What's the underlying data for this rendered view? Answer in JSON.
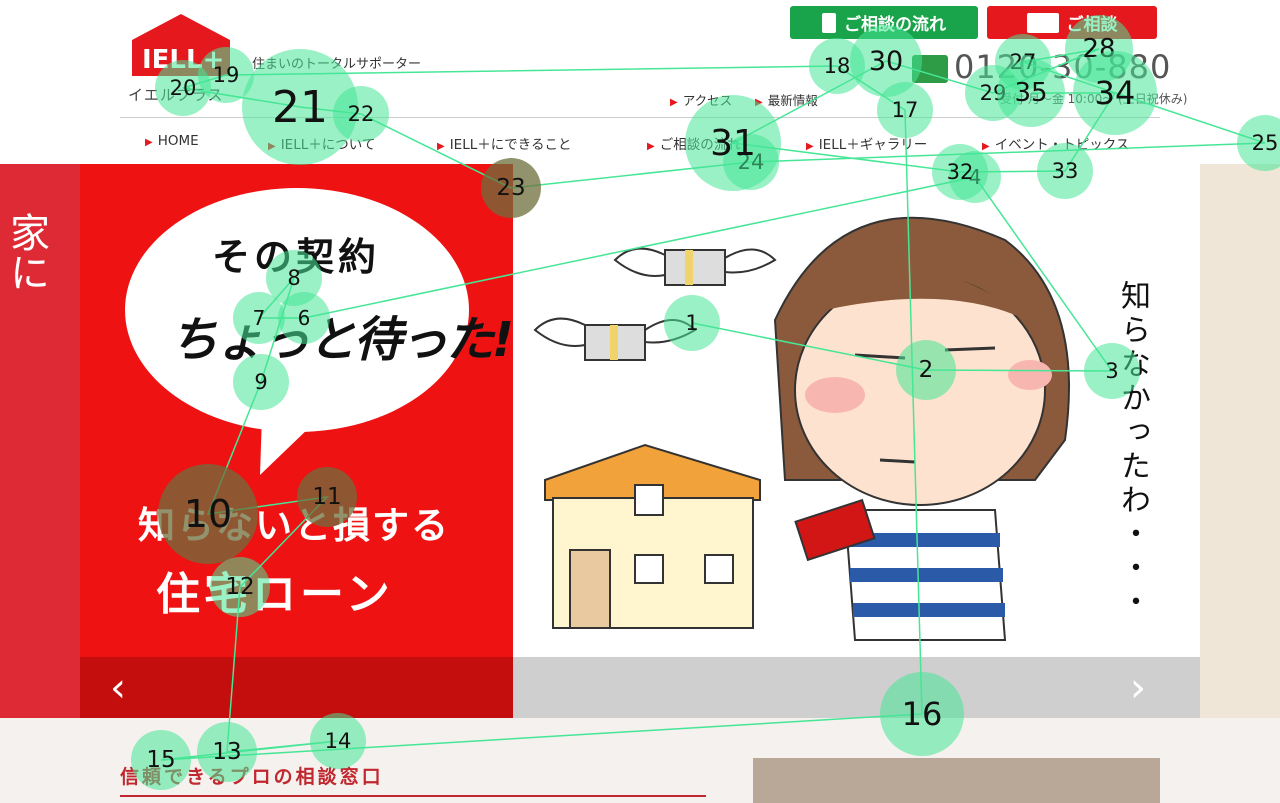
{
  "header": {
    "logo_text": "IELL+",
    "logo_sub": "イエルプラス",
    "tagline": "住まいのトータルサポーター",
    "btn_flow": "ご相談の流れ",
    "btn_consult": "ご相談",
    "phone": "0120-30-880",
    "hours": "受付 月〜金 10:00〜 (土日祝休み)",
    "links": [
      "アクセス",
      "最新情報"
    ]
  },
  "nav": [
    "HOME",
    "IELL＋について",
    "IELL＋にできること",
    "ご相談の流れ",
    "IELL＋ギャラリー",
    "イベント・トピックス"
  ],
  "hero": {
    "strip_text": "家に",
    "bubble_line1": "その契約",
    "bubble_line2": "ちょっと待った!",
    "line3": "知らないと損する",
    "line4": "住宅ローン",
    "vertical": "知らなかったわ・・・",
    "prev": "‹",
    "next": "›"
  },
  "section": {
    "title": "信頼できるプロの相談窓口"
  },
  "gaze_fixations": [
    {
      "n": "1"
    },
    {
      "n": "2"
    },
    {
      "n": "3"
    },
    {
      "n": "4"
    },
    {
      "n": "6"
    },
    {
      "n": "7"
    },
    {
      "n": "8"
    },
    {
      "n": "9"
    },
    {
      "n": "10"
    },
    {
      "n": "11"
    },
    {
      "n": "12"
    },
    {
      "n": "13"
    },
    {
      "n": "14"
    },
    {
      "n": "15"
    },
    {
      "n": "16"
    },
    {
      "n": "17"
    },
    {
      "n": "18"
    },
    {
      "n": "19"
    },
    {
      "n": "20"
    },
    {
      "n": "21"
    },
    {
      "n": "22"
    },
    {
      "n": "23"
    },
    {
      "n": "24"
    },
    {
      "n": "25"
    },
    {
      "n": "27"
    },
    {
      "n": "28"
    },
    {
      "n": "29"
    },
    {
      "n": "30"
    },
    {
      "n": "31"
    },
    {
      "n": "32"
    },
    {
      "n": "33"
    },
    {
      "n": "34"
    },
    {
      "n": "35"
    }
  ],
  "colors": {
    "brand_red": "#e5181e",
    "brand_green": "#19a34a",
    "gaze": "#46e696"
  }
}
